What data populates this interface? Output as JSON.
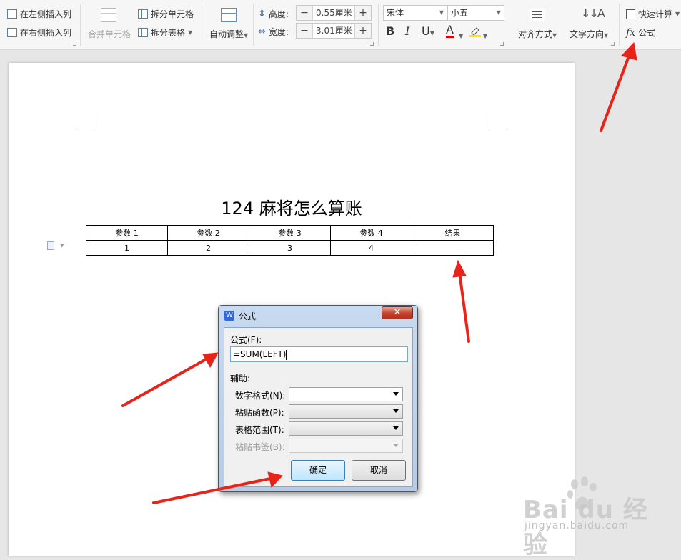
{
  "ribbon": {
    "insert_left_col": "在左侧插入列",
    "insert_right_col": "在右侧插入列",
    "merge_cells": "合并单元格",
    "split_cells": "拆分单元格",
    "split_table": "拆分表格",
    "auto_fit": "自动调整",
    "height_label": "高度:",
    "height_value": "0.55厘米",
    "width_label": "宽度:",
    "width_value": "3.01厘米",
    "font_name": "宋体",
    "font_size": "小五",
    "bold": "B",
    "italic": "I",
    "underline": "U",
    "font_color": "A",
    "align": "对齐方式",
    "text_direction": "文字方向",
    "quick_calc": "快速计算",
    "fx_symbol": "fx",
    "formula": "公式"
  },
  "document": {
    "title": "124 麻将怎么算账",
    "table": {
      "headers": [
        "参数 1",
        "参数 2",
        "参数 3",
        "参数 4",
        "结果"
      ],
      "rows": [
        [
          "1",
          "2",
          "3",
          "4",
          ""
        ]
      ]
    }
  },
  "dialog": {
    "title": "公式",
    "formula_label": "公式(F):",
    "formula_value": "=SUM(LEFT)",
    "helper_label": "辅助:",
    "number_format_label": "数字格式(N):",
    "paste_function_label": "粘贴函数(P):",
    "table_range_label": "表格范围(T):",
    "paste_bookmark_label": "粘贴书签(B):",
    "ok": "确定",
    "cancel": "取消",
    "close": "✕"
  },
  "watermark": {
    "main": "Bai du 经验",
    "sub": "jingyan.baidu.com"
  },
  "colors": {
    "arrow": "#e8231a",
    "dialog_frame": "#b6cbe6"
  }
}
